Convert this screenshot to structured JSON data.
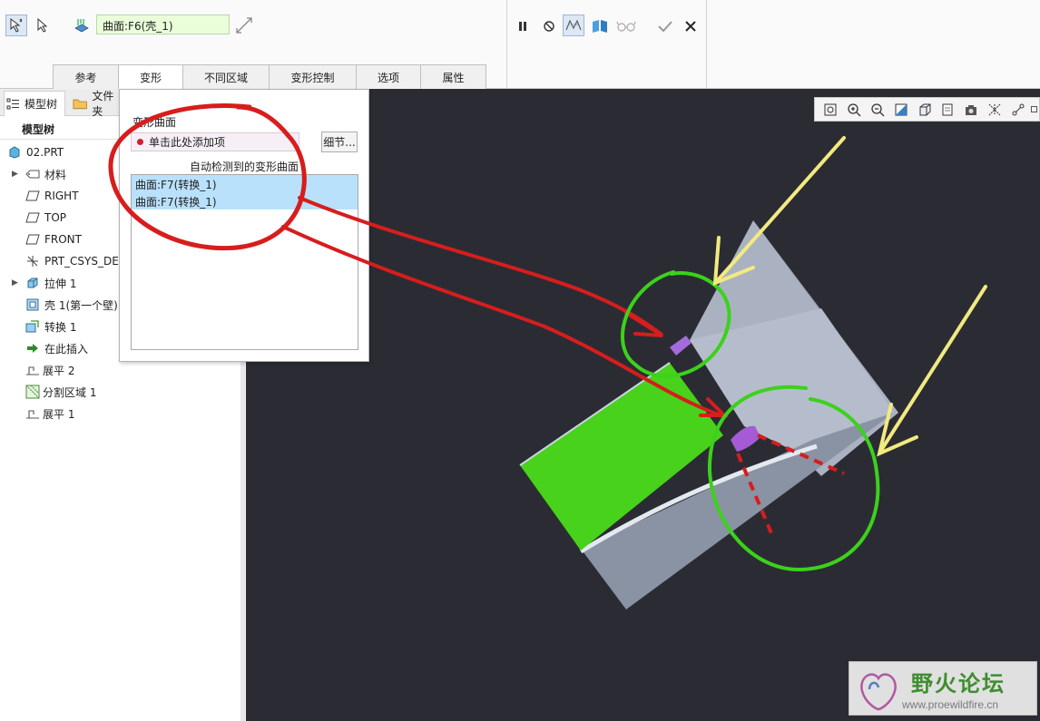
{
  "toolbar": {
    "surface_field_value": "曲面:F6(壳_1)",
    "tabs": [
      {
        "label": "参考"
      },
      {
        "label": "变形"
      },
      {
        "label": "不同区域"
      },
      {
        "label": "变形控制"
      },
      {
        "label": "选项"
      },
      {
        "label": "属性"
      }
    ],
    "active_tab": "变形"
  },
  "left_panel": {
    "tabs": [
      {
        "label": "模型树"
      },
      {
        "label": "文件夹"
      }
    ],
    "tree_header": "模型树",
    "tree": [
      {
        "label": "02.PRT",
        "icon": "part-icon",
        "expandable": false
      },
      {
        "label": "材料",
        "icon": "material-icon",
        "expandable": true
      },
      {
        "label": "RIGHT",
        "icon": "datum-plane-icon",
        "expandable": false
      },
      {
        "label": "TOP",
        "icon": "datum-plane-icon",
        "expandable": false
      },
      {
        "label": "FRONT",
        "icon": "datum-plane-icon",
        "expandable": false
      },
      {
        "label": "PRT_CSYS_DEF",
        "icon": "csys-icon",
        "expandable": false
      },
      {
        "label": "拉伸 1",
        "icon": "extrude-icon",
        "expandable": true
      },
      {
        "label": "壳 1(第一个壁)",
        "icon": "shell-icon",
        "expandable": false
      },
      {
        "label": "转换 1",
        "icon": "convert-icon",
        "expandable": false
      },
      {
        "label": "在此插入",
        "icon": "insert-here-icon",
        "expandable": false
      },
      {
        "label": "展平 2",
        "icon": "flatten-icon",
        "expandable": false
      },
      {
        "label": "分割区域 1",
        "icon": "split-area-icon",
        "expandable": false
      },
      {
        "label": "展平 1",
        "icon": "flatten-icon",
        "expandable": false
      }
    ]
  },
  "popup": {
    "section_label": "变形曲面",
    "collector_placeholder": "单击此处添加项",
    "details_button": "细节...",
    "auto_detected_label": "自动检测到的变形曲面",
    "detected_items": [
      "曲面:F7(转换_1)",
      "曲面:F7(转换_1)"
    ]
  },
  "watermark": {
    "title": "野火论坛",
    "url": "www.proewildfire.cn"
  },
  "colors": {
    "viewport_bg": "#2b2c33",
    "part_face": "#9aa3b4",
    "green_surface": "#48d21b",
    "annotation_red": "#d71d1d",
    "annotation_green": "#3cd11c",
    "annotation_yellow": "#f2ea80",
    "selection_blue": "#b9e1fb"
  }
}
